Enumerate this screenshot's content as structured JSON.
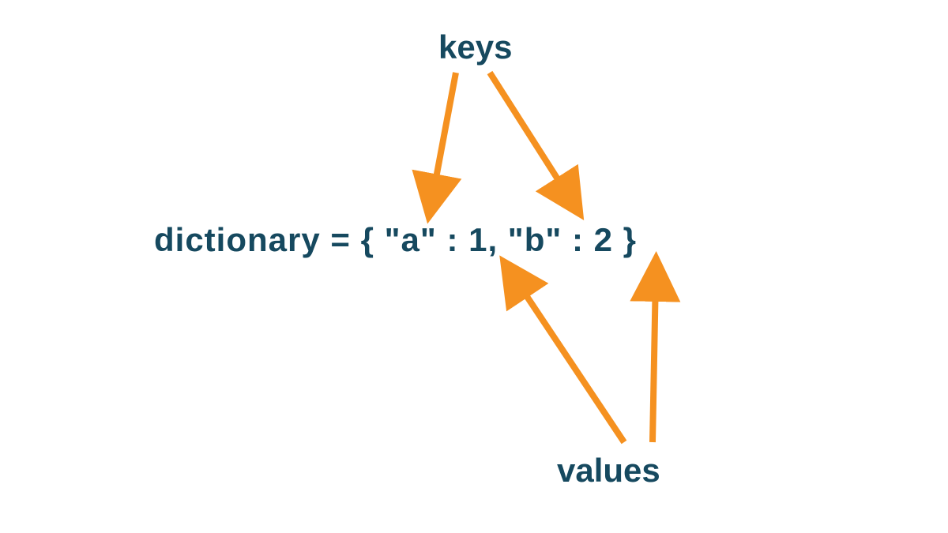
{
  "labels": {
    "keys": "keys",
    "values": "values"
  },
  "code": "dictionary = { \"a\" : 1, \"b\" : 2 }",
  "colors": {
    "text": "#16495f",
    "arrow": "#f59120"
  }
}
